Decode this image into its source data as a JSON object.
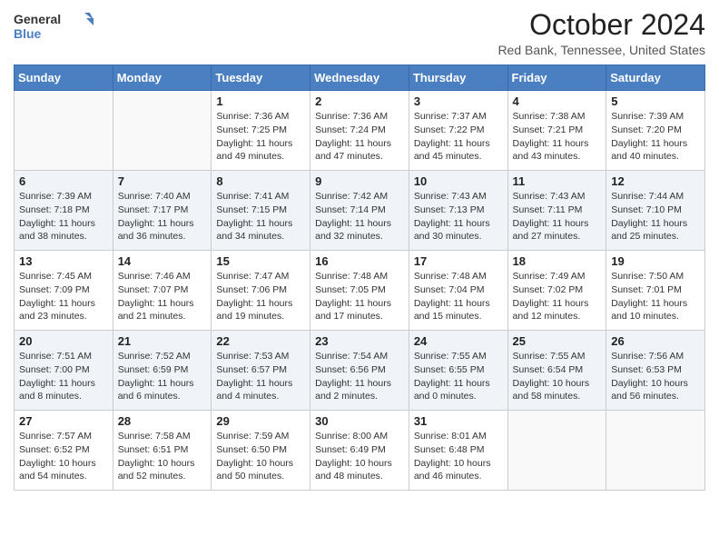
{
  "header": {
    "logo_line1": "General",
    "logo_line2": "Blue",
    "month_title": "October 2024",
    "location": "Red Bank, Tennessee, United States"
  },
  "days_of_week": [
    "Sunday",
    "Monday",
    "Tuesday",
    "Wednesday",
    "Thursday",
    "Friday",
    "Saturday"
  ],
  "weeks": [
    [
      {
        "day": "",
        "sunrise": "",
        "sunset": "",
        "daylight": ""
      },
      {
        "day": "",
        "sunrise": "",
        "sunset": "",
        "daylight": ""
      },
      {
        "day": "1",
        "sunrise": "Sunrise: 7:36 AM",
        "sunset": "Sunset: 7:25 PM",
        "daylight": "Daylight: 11 hours and 49 minutes."
      },
      {
        "day": "2",
        "sunrise": "Sunrise: 7:36 AM",
        "sunset": "Sunset: 7:24 PM",
        "daylight": "Daylight: 11 hours and 47 minutes."
      },
      {
        "day": "3",
        "sunrise": "Sunrise: 7:37 AM",
        "sunset": "Sunset: 7:22 PM",
        "daylight": "Daylight: 11 hours and 45 minutes."
      },
      {
        "day": "4",
        "sunrise": "Sunrise: 7:38 AM",
        "sunset": "Sunset: 7:21 PM",
        "daylight": "Daylight: 11 hours and 43 minutes."
      },
      {
        "day": "5",
        "sunrise": "Sunrise: 7:39 AM",
        "sunset": "Sunset: 7:20 PM",
        "daylight": "Daylight: 11 hours and 40 minutes."
      }
    ],
    [
      {
        "day": "6",
        "sunrise": "Sunrise: 7:39 AM",
        "sunset": "Sunset: 7:18 PM",
        "daylight": "Daylight: 11 hours and 38 minutes."
      },
      {
        "day": "7",
        "sunrise": "Sunrise: 7:40 AM",
        "sunset": "Sunset: 7:17 PM",
        "daylight": "Daylight: 11 hours and 36 minutes."
      },
      {
        "day": "8",
        "sunrise": "Sunrise: 7:41 AM",
        "sunset": "Sunset: 7:15 PM",
        "daylight": "Daylight: 11 hours and 34 minutes."
      },
      {
        "day": "9",
        "sunrise": "Sunrise: 7:42 AM",
        "sunset": "Sunset: 7:14 PM",
        "daylight": "Daylight: 11 hours and 32 minutes."
      },
      {
        "day": "10",
        "sunrise": "Sunrise: 7:43 AM",
        "sunset": "Sunset: 7:13 PM",
        "daylight": "Daylight: 11 hours and 30 minutes."
      },
      {
        "day": "11",
        "sunrise": "Sunrise: 7:43 AM",
        "sunset": "Sunset: 7:11 PM",
        "daylight": "Daylight: 11 hours and 27 minutes."
      },
      {
        "day": "12",
        "sunrise": "Sunrise: 7:44 AM",
        "sunset": "Sunset: 7:10 PM",
        "daylight": "Daylight: 11 hours and 25 minutes."
      }
    ],
    [
      {
        "day": "13",
        "sunrise": "Sunrise: 7:45 AM",
        "sunset": "Sunset: 7:09 PM",
        "daylight": "Daylight: 11 hours and 23 minutes."
      },
      {
        "day": "14",
        "sunrise": "Sunrise: 7:46 AM",
        "sunset": "Sunset: 7:07 PM",
        "daylight": "Daylight: 11 hours and 21 minutes."
      },
      {
        "day": "15",
        "sunrise": "Sunrise: 7:47 AM",
        "sunset": "Sunset: 7:06 PM",
        "daylight": "Daylight: 11 hours and 19 minutes."
      },
      {
        "day": "16",
        "sunrise": "Sunrise: 7:48 AM",
        "sunset": "Sunset: 7:05 PM",
        "daylight": "Daylight: 11 hours and 17 minutes."
      },
      {
        "day": "17",
        "sunrise": "Sunrise: 7:48 AM",
        "sunset": "Sunset: 7:04 PM",
        "daylight": "Daylight: 11 hours and 15 minutes."
      },
      {
        "day": "18",
        "sunrise": "Sunrise: 7:49 AM",
        "sunset": "Sunset: 7:02 PM",
        "daylight": "Daylight: 11 hours and 12 minutes."
      },
      {
        "day": "19",
        "sunrise": "Sunrise: 7:50 AM",
        "sunset": "Sunset: 7:01 PM",
        "daylight": "Daylight: 11 hours and 10 minutes."
      }
    ],
    [
      {
        "day": "20",
        "sunrise": "Sunrise: 7:51 AM",
        "sunset": "Sunset: 7:00 PM",
        "daylight": "Daylight: 11 hours and 8 minutes."
      },
      {
        "day": "21",
        "sunrise": "Sunrise: 7:52 AM",
        "sunset": "Sunset: 6:59 PM",
        "daylight": "Daylight: 11 hours and 6 minutes."
      },
      {
        "day": "22",
        "sunrise": "Sunrise: 7:53 AM",
        "sunset": "Sunset: 6:57 PM",
        "daylight": "Daylight: 11 hours and 4 minutes."
      },
      {
        "day": "23",
        "sunrise": "Sunrise: 7:54 AM",
        "sunset": "Sunset: 6:56 PM",
        "daylight": "Daylight: 11 hours and 2 minutes."
      },
      {
        "day": "24",
        "sunrise": "Sunrise: 7:55 AM",
        "sunset": "Sunset: 6:55 PM",
        "daylight": "Daylight: 11 hours and 0 minutes."
      },
      {
        "day": "25",
        "sunrise": "Sunrise: 7:55 AM",
        "sunset": "Sunset: 6:54 PM",
        "daylight": "Daylight: 10 hours and 58 minutes."
      },
      {
        "day": "26",
        "sunrise": "Sunrise: 7:56 AM",
        "sunset": "Sunset: 6:53 PM",
        "daylight": "Daylight: 10 hours and 56 minutes."
      }
    ],
    [
      {
        "day": "27",
        "sunrise": "Sunrise: 7:57 AM",
        "sunset": "Sunset: 6:52 PM",
        "daylight": "Daylight: 10 hours and 54 minutes."
      },
      {
        "day": "28",
        "sunrise": "Sunrise: 7:58 AM",
        "sunset": "Sunset: 6:51 PM",
        "daylight": "Daylight: 10 hours and 52 minutes."
      },
      {
        "day": "29",
        "sunrise": "Sunrise: 7:59 AM",
        "sunset": "Sunset: 6:50 PM",
        "daylight": "Daylight: 10 hours and 50 minutes."
      },
      {
        "day": "30",
        "sunrise": "Sunrise: 8:00 AM",
        "sunset": "Sunset: 6:49 PM",
        "daylight": "Daylight: 10 hours and 48 minutes."
      },
      {
        "day": "31",
        "sunrise": "Sunrise: 8:01 AM",
        "sunset": "Sunset: 6:48 PM",
        "daylight": "Daylight: 10 hours and 46 minutes."
      },
      {
        "day": "",
        "sunrise": "",
        "sunset": "",
        "daylight": ""
      },
      {
        "day": "",
        "sunrise": "",
        "sunset": "",
        "daylight": ""
      }
    ]
  ]
}
